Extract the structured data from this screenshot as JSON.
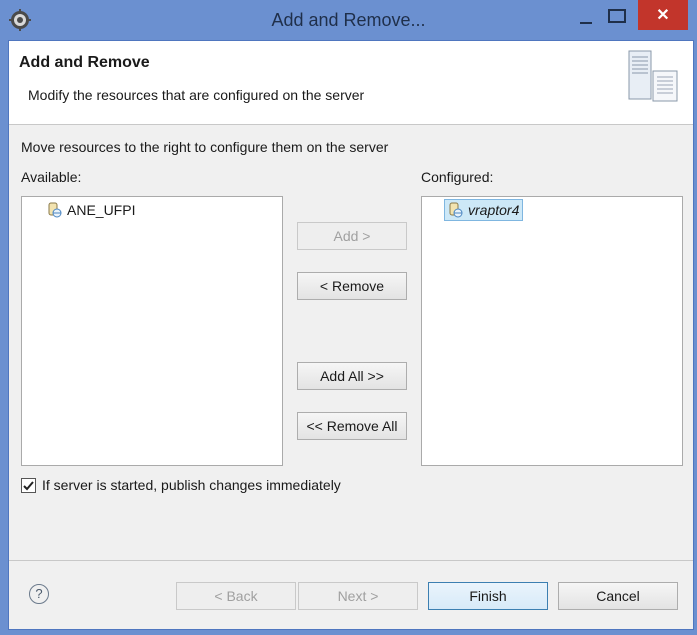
{
  "window": {
    "title": "Add and Remove...",
    "close_glyph": "✕"
  },
  "header": {
    "title": "Add and Remove",
    "description": "Modify the resources that are configured on the server"
  },
  "instructions": "Move resources to the right to configure them on the server",
  "available": {
    "label": "Available:",
    "items": [
      {
        "name": "ANE_UFPI"
      }
    ]
  },
  "configured": {
    "label": "Configured:",
    "items": [
      {
        "name": "vraptor4",
        "selected": true
      }
    ]
  },
  "buttons": {
    "add": "Add >",
    "remove": "< Remove",
    "add_all": "Add All >>",
    "remove_all": "<< Remove All",
    "back": "< Back",
    "next": "Next >",
    "finish": "Finish",
    "cancel": "Cancel",
    "help": "?"
  },
  "options": {
    "publish_immediately": {
      "label": "If server is started, publish changes immediately",
      "checked": true
    }
  },
  "icons": {
    "app": "gear-icon",
    "header": "server-icon",
    "project": "web-project-icon",
    "help": "help-icon"
  }
}
